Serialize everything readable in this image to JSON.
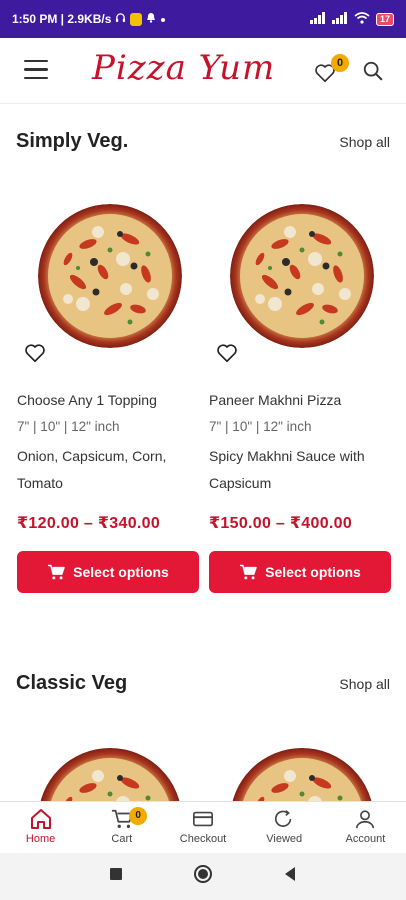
{
  "status_bar": {
    "time_speed": "1:50 PM | 2.9KB/s",
    "battery": "17"
  },
  "header": {
    "logo": "Pizza Yum",
    "wishlist_count": "0"
  },
  "sections": [
    {
      "title": "Simply Veg.",
      "shop_all": "Shop all",
      "products": [
        {
          "name": "Choose Any 1 Topping",
          "sizes": "7\" | 10\" | 12\" inch",
          "description": "Onion, Capsicum, Corn, Tomato",
          "price": "₹120.00 – ₹340.00",
          "button": "Select options"
        },
        {
          "name": "Paneer Makhni Pizza",
          "sizes": "7\" | 10\" | 12\" inch",
          "description": "Spicy Makhni Sauce with Capsicum",
          "price": "₹150.00 – ₹400.00",
          "button": "Select options"
        }
      ]
    },
    {
      "title": "Classic Veg",
      "shop_all": "Shop all"
    }
  ],
  "bottom_nav": {
    "items": [
      {
        "label": "Home",
        "icon": "home-icon"
      },
      {
        "label": "Cart",
        "icon": "cart-icon"
      },
      {
        "label": "Checkout",
        "icon": "card-icon"
      },
      {
        "label": "Viewed",
        "icon": "history-icon"
      },
      {
        "label": "Account",
        "icon": "user-icon"
      }
    ],
    "cart_count": "0"
  },
  "colors": {
    "brand": "#c4132b",
    "button": "#e31837",
    "status_bar": "#3d1a9e",
    "badge": "#f2a900"
  }
}
